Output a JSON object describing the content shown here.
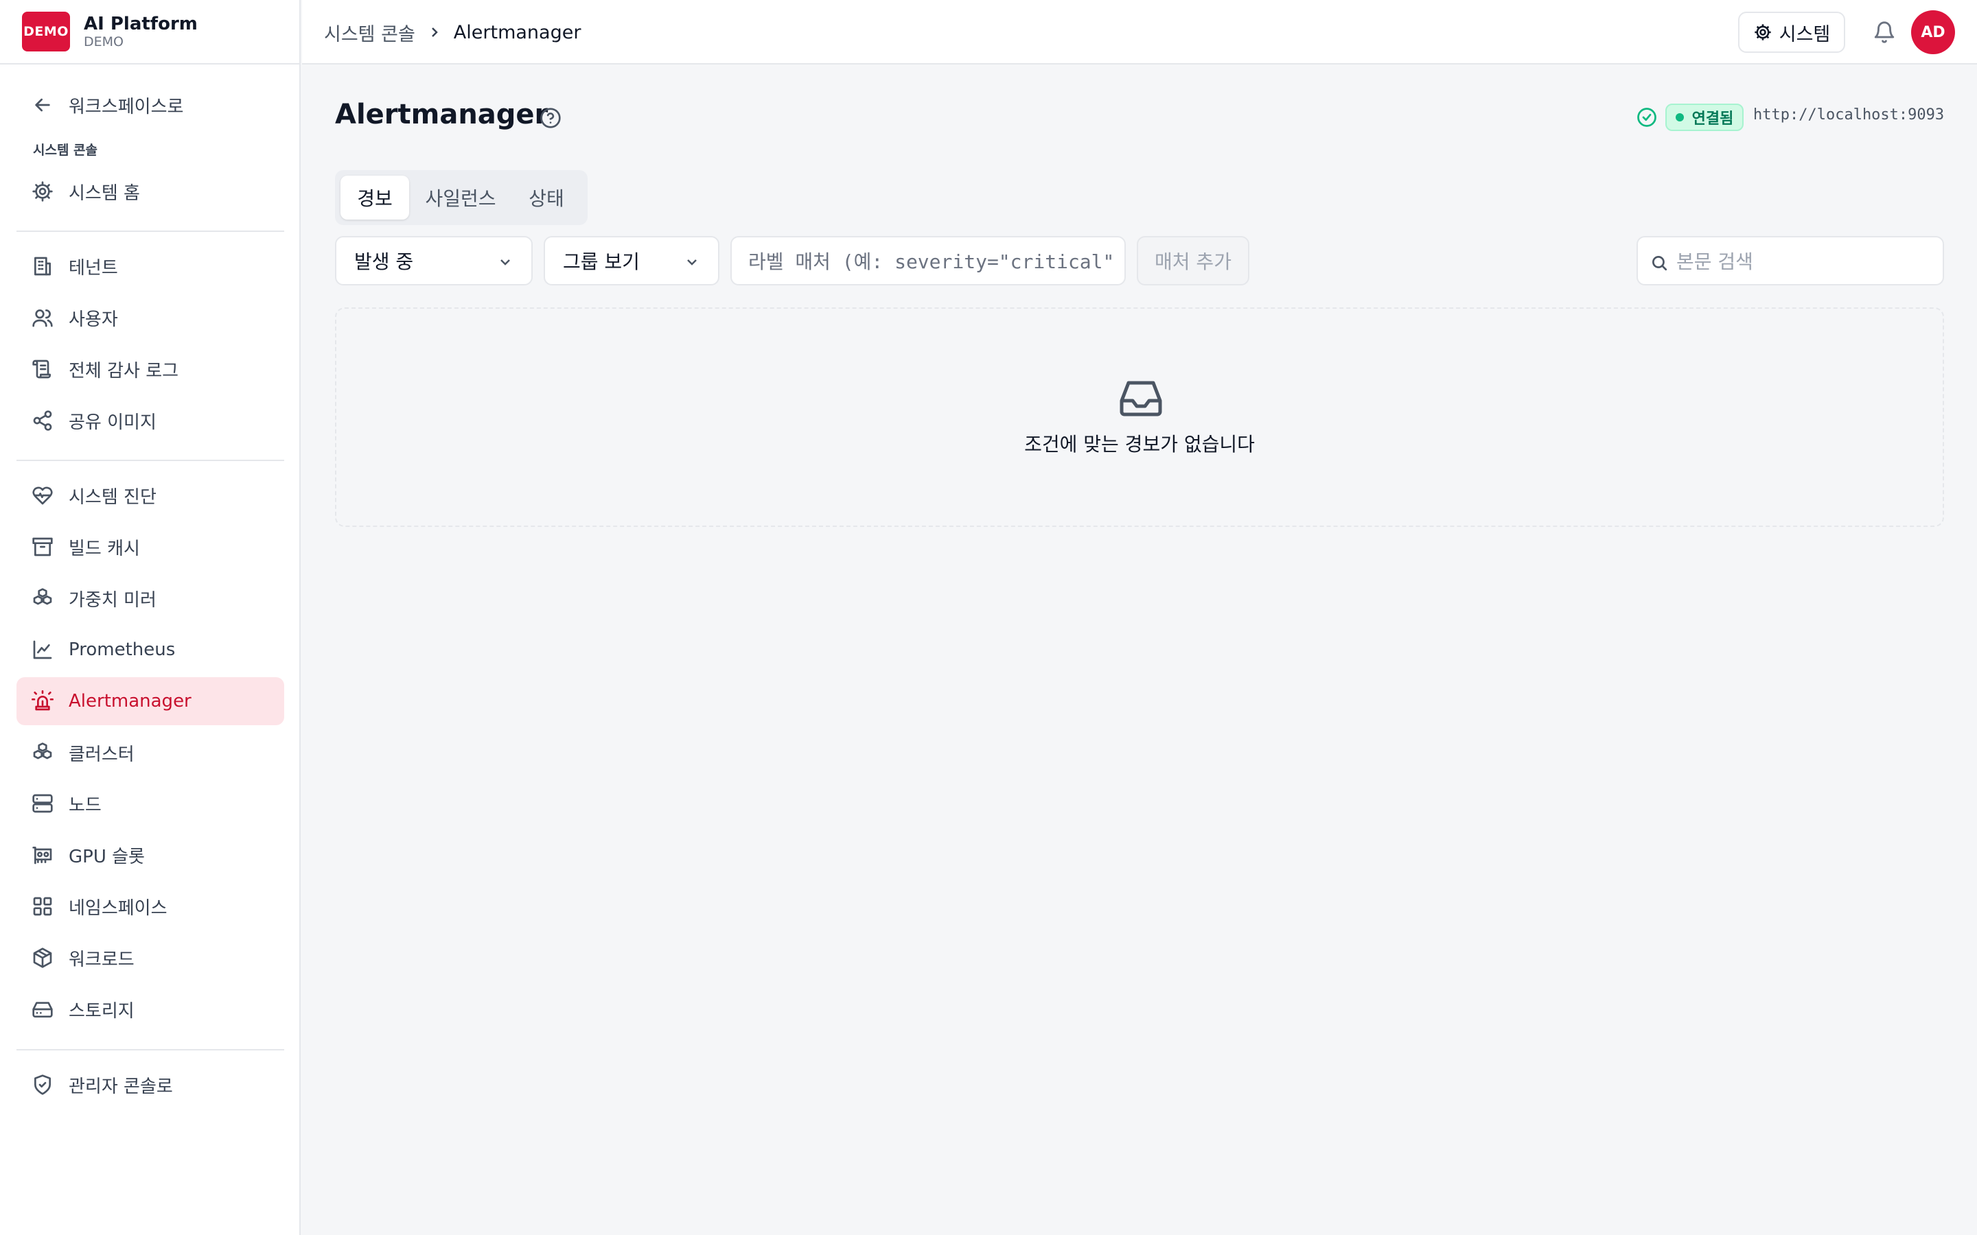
{
  "brand": {
    "logo_text": "DEMO",
    "name": "AI Platform",
    "subtitle": "DEMO"
  },
  "sidebar": {
    "back_label": "워크스페이스로",
    "section_label": "시스템 콘솔",
    "items": [
      {
        "label": "시스템 홈",
        "icon": "gear-icon"
      },
      {
        "label": "테넌트",
        "icon": "building-icon"
      },
      {
        "label": "사용자",
        "icon": "users-icon"
      },
      {
        "label": "전체 감사 로그",
        "icon": "scroll-icon"
      },
      {
        "label": "공유 이미지",
        "icon": "share-icon"
      },
      {
        "label": "시스템 진단",
        "icon": "heart-pulse-icon"
      },
      {
        "label": "빌드 캐시",
        "icon": "archive-icon"
      },
      {
        "label": "가중치 미러",
        "icon": "boxes-icon"
      },
      {
        "label": "Prometheus",
        "icon": "line-chart-icon"
      },
      {
        "label": "Alertmanager",
        "icon": "siren-icon",
        "active": true
      },
      {
        "label": "클러스터",
        "icon": "cluster-icon"
      },
      {
        "label": "노드",
        "icon": "server-icon"
      },
      {
        "label": "GPU 슬롯",
        "icon": "gpu-icon"
      },
      {
        "label": "네임스페이스",
        "icon": "grid-icon"
      },
      {
        "label": "워크로드",
        "icon": "package-icon"
      },
      {
        "label": "스토리지",
        "icon": "hard-drive-icon"
      },
      {
        "label": "관리자 콘솔로",
        "icon": "shield-check-icon"
      }
    ]
  },
  "header": {
    "breadcrumb_parent": "시스템 콘솔",
    "breadcrumb_current": "Alertmanager",
    "system_button": "시스템",
    "avatar_initials": "AD"
  },
  "main": {
    "title": "Alertmanager",
    "connection_status": "연결됨",
    "connection_url": "http://localhost:9093",
    "tabs": [
      "경보",
      "사일런스",
      "상태"
    ],
    "active_tab": "경보",
    "state_filter": "발생 중",
    "group_filter": "그룹 보기",
    "matcher_placeholder": "라벨 매처 (예: severity=\"critical\"",
    "add_matcher_button": "매처 추가",
    "search_placeholder": "본문 검색",
    "empty_message": "조건에 맞는 경보가 없습니다"
  },
  "colors": {
    "accent": "#dc143c",
    "active_bg": "#fde4e8",
    "success": "#10b981"
  }
}
